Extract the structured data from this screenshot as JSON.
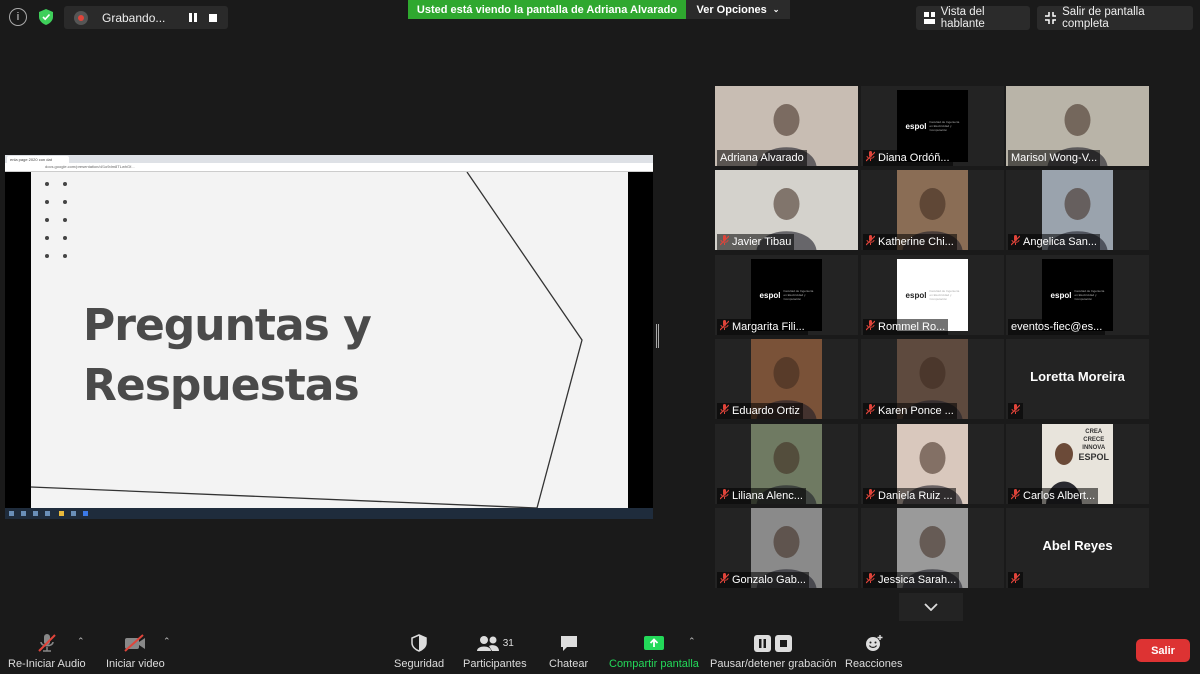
{
  "recording": {
    "label": "Grabando..."
  },
  "banner": {
    "text": "Usted está viendo la pantalla de Adriana Alvarado"
  },
  "view_options": {
    "label": "Ver Opciones"
  },
  "speaker_view": {
    "label": "Vista del hablante"
  },
  "exit_fullscreen": {
    "label": "Salir de pantalla completa"
  },
  "shared_screen": {
    "browser_tab": "enla page 2020 con dat",
    "url": "docs.google.com/presentation/d/1o9dm8TLwhGf...",
    "slide_title_line1": "Preguntas y",
    "slide_title_line2": "Respuestas"
  },
  "participants": [
    {
      "name": "Adriana Alvarado",
      "muted": false,
      "active": false,
      "kind": "video",
      "bg": "#c8bdb3"
    },
    {
      "name": "Diana Ordóñ...",
      "muted": true,
      "kind": "espol-black"
    },
    {
      "name": "Marisol Wong-V...",
      "muted": false,
      "active": true,
      "kind": "video",
      "bg": "#b9b4a8"
    },
    {
      "name": "Javier Tibau",
      "muted": true,
      "kind": "video",
      "bg": "#d4d2cc"
    },
    {
      "name": "Katherine Chi...",
      "muted": true,
      "kind": "video",
      "bg": "#8a6d55"
    },
    {
      "name": "Angelica San...",
      "muted": true,
      "kind": "video",
      "bg": "#9aa3ad"
    },
    {
      "name": "Margarita Fili...",
      "muted": true,
      "kind": "espol-black"
    },
    {
      "name": "Rommel Ro...",
      "muted": true,
      "kind": "espol-white"
    },
    {
      "name": "eventos-fiec@es...",
      "muted": false,
      "kind": "espol-black"
    },
    {
      "name": "Eduardo Ortiz",
      "muted": true,
      "kind": "video",
      "bg": "#7a5238"
    },
    {
      "name": "Karen Ponce ...",
      "muted": true,
      "kind": "video",
      "bg": "#5e4a3e"
    },
    {
      "name": "Loretta Moreira",
      "muted": true,
      "kind": "name"
    },
    {
      "name": "Liliana Alenc...",
      "muted": true,
      "kind": "video",
      "bg": "#6f7a62"
    },
    {
      "name": "Daniela Ruiz ...",
      "muted": true,
      "kind": "video",
      "bg": "#d9c8bd"
    },
    {
      "name": "Carlos Albert...",
      "muted": true,
      "kind": "espol-poster",
      "poster": [
        "CREA",
        "CRECE",
        "INNOVA",
        "ESPOL"
      ]
    },
    {
      "name": "Gonzalo Gab...",
      "muted": true,
      "kind": "video",
      "bg": "#8a8a8a"
    },
    {
      "name": "Jessica Sarah...",
      "muted": true,
      "kind": "video",
      "bg": "#9a9a9a"
    },
    {
      "name": "Abel Reyes",
      "muted": true,
      "kind": "name"
    }
  ],
  "espol": {
    "logo": "espol",
    "sub": "Facultad de Ingeniería en Electricidad y Computación"
  },
  "toolbar": {
    "audio": "Re-Iniciar Audio",
    "video": "Iniciar video",
    "security": "Seguridad",
    "participants": "Participantes",
    "participants_count": "31",
    "chat": "Chatear",
    "share": "Compartir pantalla",
    "pause_record": "Pausar/detener grabación",
    "reactions": "Reacciones",
    "leave": "Salir"
  },
  "colors": {
    "banner_green": "#2fa82f",
    "share_green": "#23d959",
    "leave_red": "#dd3333",
    "mute_red": "#e0443a",
    "active_border": "#d7e04a"
  }
}
